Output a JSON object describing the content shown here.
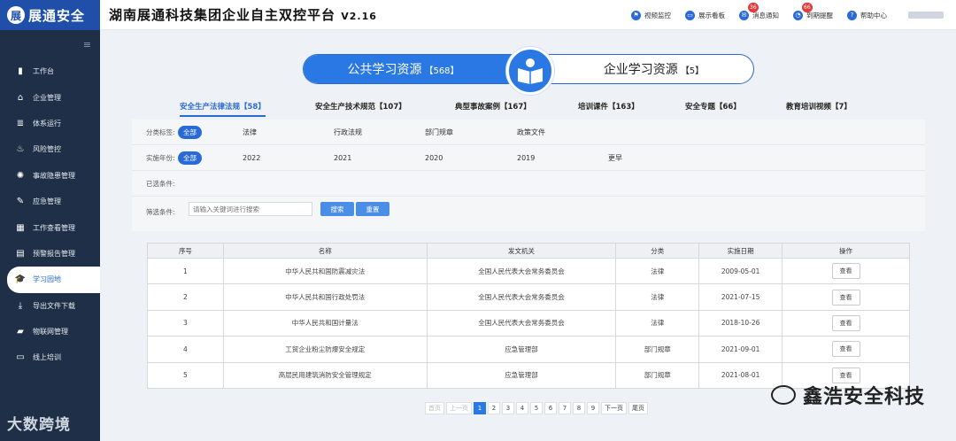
{
  "sidebar": {
    "brand_logo": "展",
    "brand_name": "展通安全",
    "collapse_icon": "≡",
    "items": [
      {
        "label": "工作台",
        "icon": "chart-icon"
      },
      {
        "label": "企业管理",
        "icon": "home-icon"
      },
      {
        "label": "体系运行",
        "icon": "layers-icon"
      },
      {
        "label": "风险管控",
        "icon": "flame-icon"
      },
      {
        "label": "事故隐患管理",
        "icon": "radiation-icon"
      },
      {
        "label": "应急管理",
        "icon": "edit-icon"
      },
      {
        "label": "工作查看管理",
        "icon": "calendar-icon"
      },
      {
        "label": "预警报告管理",
        "icon": "doc-icon"
      },
      {
        "label": "学习园地",
        "icon": "graduation-cap-icon"
      },
      {
        "label": "导出文件下载",
        "icon": "download-icon"
      },
      {
        "label": "物联网管理",
        "icon": "stack-icon"
      },
      {
        "label": "线上培训",
        "icon": "screen-icon"
      }
    ],
    "active_index": 8,
    "watermark": "大数跨境"
  },
  "header": {
    "title": "湖南展通科技集团企业自主双控平台",
    "version": "V2.16",
    "nav": [
      {
        "label": "视频监控",
        "icon": "flag-icon",
        "badge": ""
      },
      {
        "label": "展示看板",
        "icon": "monitor-icon",
        "badge": ""
      },
      {
        "label": "消息通知",
        "icon": "message-icon",
        "badge": "36"
      },
      {
        "label": "到期提醒",
        "icon": "bell-icon",
        "badge": "66"
      },
      {
        "label": "帮助中心",
        "icon": "help-icon",
        "badge": ""
      }
    ]
  },
  "switcher": {
    "left_label": "公共学习资源",
    "left_count": "【568】",
    "right_label": "企业学习资源",
    "right_count": "【5】"
  },
  "tabs": [
    {
      "label": "安全生产法律法规【58】"
    },
    {
      "label": "安全生产技术规范【107】"
    },
    {
      "label": "典型事故案例【167】"
    },
    {
      "label": "培训课件【163】"
    },
    {
      "label": "安全专题【66】"
    },
    {
      "label": "教育培训视频【7】"
    }
  ],
  "filter": {
    "category_label": "分类标签:",
    "category_options": [
      "全部",
      "法律",
      "行政法规",
      "部门规章",
      "政策文件"
    ],
    "year_label": "实施年份:",
    "year_options": [
      "全部",
      "2022",
      "2021",
      "2020",
      "2019",
      "更早"
    ],
    "selected_label": "已选条件:",
    "search_label": "筛选条件:",
    "search_placeholder": "请输入关键词进行搜索",
    "search_button": "搜索",
    "reset_button": "重置"
  },
  "table": {
    "headers": [
      "序号",
      "名称",
      "发文机关",
      "分类",
      "实施日期",
      "操作"
    ],
    "rows": [
      [
        "1",
        "中华人民共和国防震减灾法",
        "全国人民代表大会常务委员会",
        "法律",
        "2009-05-01",
        "查看"
      ],
      [
        "2",
        "中华人民共和国行政处罚法",
        "全国人民代表大会常务委员会",
        "法律",
        "2021-07-15",
        "查看"
      ],
      [
        "3",
        "中华人民共和国计量法",
        "全国人民代表大会常务委员会",
        "法律",
        "2018-10-26",
        "查看"
      ],
      [
        "4",
        "工贸企业粉尘防爆安全规定",
        "应急管理部",
        "部门规章",
        "2021-09-01",
        "查看"
      ],
      [
        "5",
        "高层民用建筑消防安全管理规定",
        "应急管理部",
        "部门规章",
        "2021-08-01",
        "查看"
      ]
    ]
  },
  "pager": {
    "first": "首页",
    "prev": "上一页",
    "pages": [
      "1",
      "2",
      "3",
      "4",
      "5",
      "6",
      "7",
      "8",
      "9"
    ],
    "current": "1",
    "next": "下一页",
    "last": "尾页"
  },
  "watermark_right": "鑫浩安全科技",
  "colors": {
    "primary": "#2a78e4",
    "sidebar": "#1e2f47",
    "badge": "#e23b3b"
  }
}
